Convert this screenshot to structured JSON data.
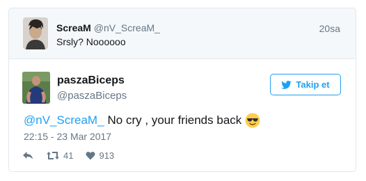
{
  "parent": {
    "display_name": "ScreaM",
    "handle": "@nV_ScreaM_",
    "time": "20sa",
    "text": "Srsly? Noooooo"
  },
  "tweet": {
    "author_name": "paszaBiceps",
    "author_handle": "@paszaBiceps",
    "follow_label": "Takip et",
    "mention": "@nV_ScreaM_",
    "body": "No cry , your friends back",
    "emoji": "sunglasses-emoji",
    "timestamp": "22:15 - 23 Mar 2017",
    "retweets": "41",
    "likes": "913"
  },
  "colors": {
    "accent": "#1da1f2",
    "muted": "#657786",
    "border": "#e1e8ed",
    "parent_bg": "#f5f8fa"
  }
}
